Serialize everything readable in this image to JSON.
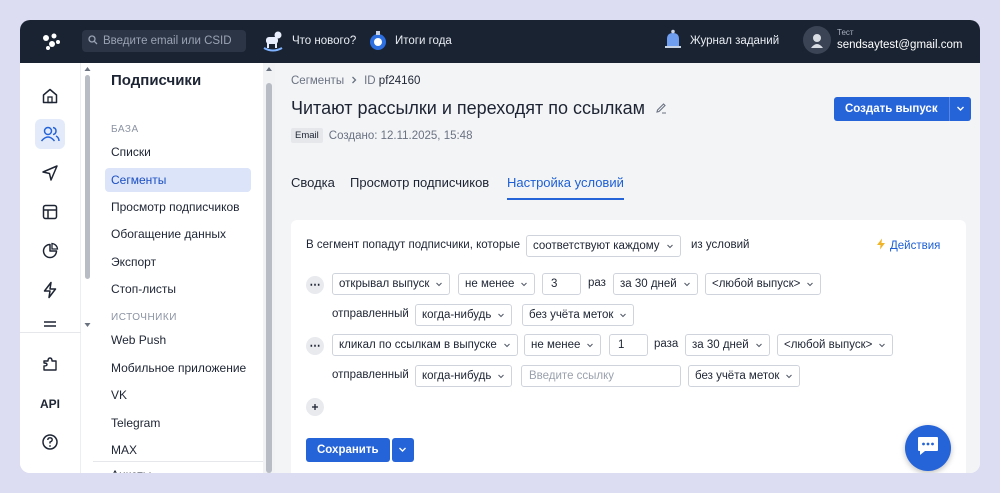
{
  "topbar": {
    "search_placeholder": "Введите email или CSID",
    "news": "Что нового?",
    "year_summary": "Итоги года",
    "jobs": "Журнал заданий",
    "user_label": "Тест",
    "user_email": "sendsaytest@gmail.com"
  },
  "rail": {
    "api": "API"
  },
  "sidebar": {
    "title": "Подписчики",
    "section_base": "БАЗА",
    "items_base": [
      "Списки",
      "Сегменты",
      "Просмотр подписчиков",
      "Обогащение данных",
      "Экспорт",
      "Стоп-листы"
    ],
    "section_sources": "ИСТОЧНИКИ",
    "items_sources": [
      "Web Push",
      "Мобильное приложение",
      "VK",
      "Telegram",
      "MAX",
      "Анкеты"
    ]
  },
  "breadcrumb": {
    "root": "Сегменты",
    "id_label": "ID",
    "id_value": "pf24160"
  },
  "page": {
    "title": "Читают рассылки и переходят по ссылкам",
    "create_button": "Создать выпуск",
    "tag": "Email",
    "created": "Создано: 12.11.2025, 15:48"
  },
  "tabs": [
    "Сводка",
    "Просмотр подписчиков",
    "Настройка условий"
  ],
  "conditions": {
    "intro": "В сегмент попадут подписчики, которые",
    "match_mode": "соответствуют каждому",
    "of_conditions": "из условий",
    "actions": "Действия",
    "rule1": {
      "action": "открывал выпуск",
      "comparator": "не менее",
      "count": "3",
      "times": "раз",
      "period": "за 30 дней",
      "issue": "<любой выпуск>",
      "sent_label": "отправленный",
      "sent_when": "когда-нибудь",
      "tags": "без учёта меток"
    },
    "rule2": {
      "action": "кликал по ссылкам в выпуске",
      "comparator": "не менее",
      "count": "1",
      "times": "раза",
      "period": "за 30 дней",
      "issue": "<любой выпуск>",
      "sent_label": "отправленный",
      "sent_when": "когда-нибудь",
      "link_placeholder": "Введите ссылку",
      "tags": "без учёта меток"
    },
    "save_button": "Сохранить"
  },
  "colors": {
    "accent": "#2563d9",
    "topbar_bg": "#1a2332",
    "active_nav_bg": "#dbe4f9"
  }
}
